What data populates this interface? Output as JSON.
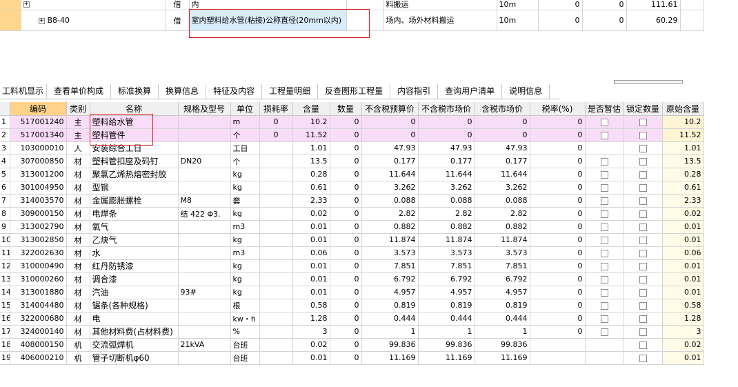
{
  "top_rows": [
    {
      "code": "",
      "type": "借",
      "name": "内",
      "unit_desc": "料搬运",
      "unit": "10m",
      "q1": "0",
      "q2": "0",
      "value": "111.61"
    },
    {
      "code": "B8-40",
      "type": "借",
      "name": "室内塑料给水管(粘接)公称直径(20mm以内)",
      "unit_desc": "场内、场外材料搬运",
      "unit": "10m",
      "q1": "0",
      "q2": "0",
      "value": "60.29"
    }
  ],
  "tabs": [
    "工料机显示",
    "查看单价构成",
    "标准换算",
    "换算信息",
    "特征及内容",
    "工程量明细",
    "反查图形工程量",
    "内容指引",
    "查询用户清单",
    "说明信息"
  ],
  "columns": [
    "编码",
    "类别",
    "名称",
    "规格及型号",
    "单位",
    "损耗率",
    "含量",
    "数量",
    "不含税预算价",
    "不含税市场价",
    "含税市场价",
    "税率(%)",
    "是否暂估",
    "锁定数量",
    "原始含量"
  ],
  "rows": [
    {
      "idx": "1",
      "code": "517001240",
      "cat": "主",
      "name": "塑料给水管",
      "spec": "",
      "unit": "m",
      "loss": "0",
      "qty": "10.2",
      "amount": "0",
      "p1": "0",
      "p2": "0",
      "p3": "0",
      "tax": "0",
      "orig": "10.2",
      "main": true
    },
    {
      "idx": "2",
      "code": "517001340",
      "cat": "主",
      "name": "塑料管件",
      "spec": "",
      "unit": "个",
      "loss": "0",
      "qty": "11.52",
      "amount": "0",
      "p1": "0",
      "p2": "0",
      "p3": "0",
      "tax": "0",
      "orig": "11.52",
      "main": true
    },
    {
      "idx": "3",
      "code": "103000010",
      "cat": "人",
      "name": "安装综合工日",
      "spec": "",
      "unit": "工日",
      "loss": "",
      "qty": "1.01",
      "amount": "0",
      "p1": "47.93",
      "p2": "47.93",
      "p3": "47.93",
      "tax": "0",
      "orig": "1.01",
      "main": false
    },
    {
      "idx": "4",
      "code": "307000850",
      "cat": "材",
      "name": "塑料管扣座及码钉",
      "spec": "DN20",
      "unit": "个",
      "loss": "",
      "qty": "13.5",
      "amount": "0",
      "p1": "0.177",
      "p2": "0.177",
      "p3": "0.177",
      "tax": "0",
      "orig": "13.5",
      "main": false
    },
    {
      "idx": "5",
      "code": "313001200",
      "cat": "材",
      "name": "聚氯乙烯热熔密封胶",
      "spec": "",
      "unit": "kg",
      "loss": "",
      "qty": "0.28",
      "amount": "0",
      "p1": "11.644",
      "p2": "11.644",
      "p3": "11.644",
      "tax": "0",
      "orig": "0.28",
      "main": false
    },
    {
      "idx": "6",
      "code": "301004950",
      "cat": "材",
      "name": "型钢",
      "spec": "",
      "unit": "kg",
      "loss": "",
      "qty": "0.61",
      "amount": "0",
      "p1": "3.262",
      "p2": "3.262",
      "p3": "3.262",
      "tax": "0",
      "orig": "0.61",
      "main": false
    },
    {
      "idx": "7",
      "code": "314003570",
      "cat": "材",
      "name": "金属膨胀螺栓",
      "spec": "M8",
      "unit": "套",
      "loss": "",
      "qty": "2.33",
      "amount": "0",
      "p1": "0.088",
      "p2": "0.088",
      "p3": "0.088",
      "tax": "0",
      "orig": "2.33",
      "main": false
    },
    {
      "idx": "8",
      "code": "309000150",
      "cat": "材",
      "name": "电焊条",
      "spec": "结 422 Φ3.",
      "unit": "kg",
      "loss": "",
      "qty": "0.02",
      "amount": "0",
      "p1": "2.82",
      "p2": "2.82",
      "p3": "2.82",
      "tax": "0",
      "orig": "0.02",
      "main": false
    },
    {
      "idx": "9",
      "code": "313002790",
      "cat": "材",
      "name": "氧气",
      "spec": "",
      "unit": "m3",
      "loss": "",
      "qty": "0.01",
      "amount": "0",
      "p1": "0.882",
      "p2": "0.882",
      "p3": "0.882",
      "tax": "0",
      "orig": "0.01",
      "main": false
    },
    {
      "idx": "10",
      "code": "313002850",
      "cat": "材",
      "name": "乙炔气",
      "spec": "",
      "unit": "kg",
      "loss": "",
      "qty": "0.01",
      "amount": "0",
      "p1": "11.874",
      "p2": "11.874",
      "p3": "11.874",
      "tax": "0",
      "orig": "0.01",
      "main": false
    },
    {
      "idx": "11",
      "code": "322002630",
      "cat": "材",
      "name": "水",
      "spec": "",
      "unit": "m3",
      "loss": "",
      "qty": "0.06",
      "amount": "0",
      "p1": "3.573",
      "p2": "3.573",
      "p3": "3.573",
      "tax": "0",
      "orig": "0.06",
      "main": false
    },
    {
      "idx": "12",
      "code": "310000490",
      "cat": "材",
      "name": "红丹防锈漆",
      "spec": "",
      "unit": "kg",
      "loss": "",
      "qty": "0.01",
      "amount": "0",
      "p1": "7.851",
      "p2": "7.851",
      "p3": "7.851",
      "tax": "0",
      "orig": "0.01",
      "main": false
    },
    {
      "idx": "13",
      "code": "310000260",
      "cat": "材",
      "name": "调合漆",
      "spec": "",
      "unit": "kg",
      "loss": "",
      "qty": "0.01",
      "amount": "0",
      "p1": "6.792",
      "p2": "6.792",
      "p3": "6.792",
      "tax": "0",
      "orig": "0.01",
      "main": false
    },
    {
      "idx": "14",
      "code": "313001880",
      "cat": "材",
      "name": "汽油",
      "spec": "93#",
      "unit": "kg",
      "loss": "",
      "qty": "0.01",
      "amount": "0",
      "p1": "4.957",
      "p2": "4.957",
      "p3": "4.957",
      "tax": "0",
      "orig": "0.01",
      "main": false
    },
    {
      "idx": "15",
      "code": "314004480",
      "cat": "材",
      "name": "锯条(各种规格)",
      "spec": "",
      "unit": "根",
      "loss": "",
      "qty": "0.58",
      "amount": "0",
      "p1": "0.819",
      "p2": "0.819",
      "p3": "0.819",
      "tax": "0",
      "orig": "0.58",
      "main": false
    },
    {
      "idx": "16",
      "code": "322000680",
      "cat": "材",
      "name": "电",
      "spec": "",
      "unit": "kw・h",
      "loss": "",
      "qty": "1.28",
      "amount": "0",
      "p1": "0.444",
      "p2": "0.444",
      "p3": "0.444",
      "tax": "0",
      "orig": "1.28",
      "main": false
    },
    {
      "idx": "17",
      "code": "324000140",
      "cat": "材",
      "name": "其他材料费(占材料费)",
      "spec": "",
      "unit": "%",
      "loss": "",
      "qty": "3",
      "amount": "0",
      "p1": "1",
      "p2": "1",
      "p3": "1",
      "tax": "0",
      "orig": "3",
      "main": false
    },
    {
      "idx": "18",
      "code": "408000150",
      "cat": "机",
      "name": "交流弧焊机",
      "spec": "21kVA",
      "unit": "台班",
      "loss": "",
      "qty": "0.02",
      "amount": "0",
      "p1": "99.836",
      "p2": "99.836",
      "p3": "99.836",
      "tax": "",
      "orig": "0.02",
      "main": false
    },
    {
      "idx": "19",
      "code": "406000210",
      "cat": "机",
      "name": "管子切断机φ60",
      "spec": "",
      "unit": "台班",
      "loss": "",
      "qty": "0.01",
      "amount": "0",
      "p1": "11.169",
      "p2": "11.169",
      "p3": "11.169",
      "tax": "",
      "orig": "0.01",
      "main": false
    }
  ]
}
